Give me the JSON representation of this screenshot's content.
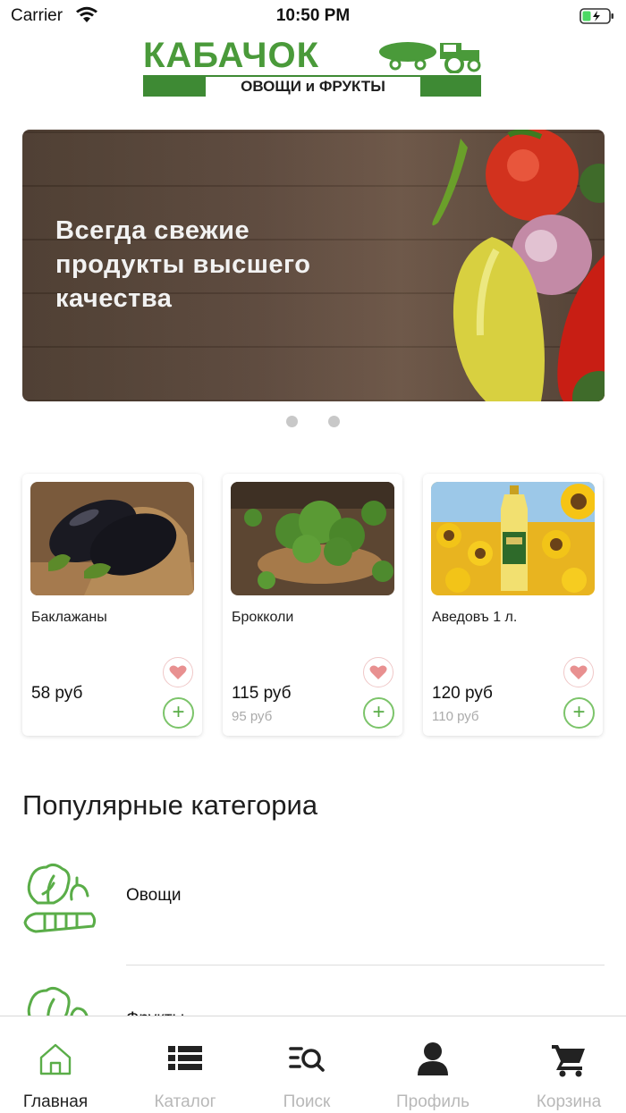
{
  "status_bar": {
    "carrier": "Carrier",
    "time": "10:50 PM"
  },
  "logo": {
    "title": "КАБАЧОК",
    "subtitle": "ОВОЩИ и ФРУКТЫ"
  },
  "banner": {
    "text": "Всегда свежие продукты высшего качества",
    "slides_count": 2
  },
  "products": [
    {
      "name": "Баклажаны",
      "price": "58 руб",
      "old_price": ""
    },
    {
      "name": "Брокколи",
      "price": "115 руб",
      "old_price": "95 руб"
    },
    {
      "name": "Аведовъ 1 л.",
      "price": "120 руб",
      "old_price": "110 руб"
    }
  ],
  "categories": {
    "title": "Популярные категориа",
    "items": [
      {
        "label": "Овощи"
      },
      {
        "label": "Фрукты"
      }
    ]
  },
  "tabbar": {
    "items": [
      {
        "label": "Главная",
        "icon": "home-icon",
        "active": true
      },
      {
        "label": "Каталог",
        "icon": "list-icon",
        "active": false
      },
      {
        "label": "Поиск",
        "icon": "search-icon",
        "active": false
      },
      {
        "label": "Профиль",
        "icon": "profile-icon",
        "active": false
      },
      {
        "label": "Корзина",
        "icon": "cart-icon",
        "active": false
      }
    ]
  },
  "colors": {
    "accent_green": "#5aad48",
    "tab_active": "#222222",
    "tab_inactive": "#b8b8b8"
  }
}
